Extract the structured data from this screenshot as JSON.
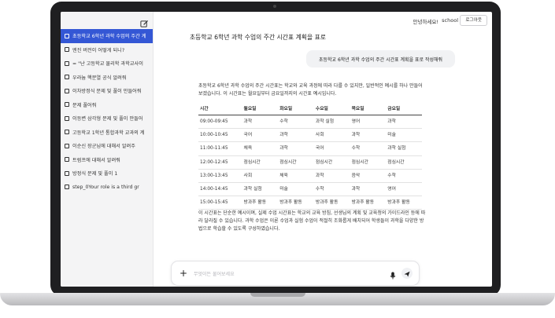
{
  "topbar": {
    "greeting": "안녕하세요!",
    "username": "school",
    "logout_label": "로그아웃"
  },
  "sidebar": {
    "conversations": [
      {
        "label": "초등학교 6학년 과학 수업의 주간 계",
        "active": true
      },
      {
        "label": "엔진 버전이 어떻게 되니?",
        "active": false
      },
      {
        "label": "= \"난 고등학교 물리학 과학교사이",
        "active": false
      },
      {
        "label": "우라늄 핵분열 공식 알려줘",
        "active": false
      },
      {
        "label": "이차방정식 문제 및 풀이 만들어줘",
        "active": false
      },
      {
        "label": "문제 풀어줘",
        "active": false
      },
      {
        "label": "이등변 삼각형 문제 및 풀이 만들어",
        "active": false
      },
      {
        "label": "고등학교 1학년 통합과학 교과의 계",
        "active": false
      },
      {
        "label": "이순신 장군님에 대해서 알려주",
        "active": false
      },
      {
        "label": "트럼프에 대해서 알려줘",
        "active": false
      },
      {
        "label": "방정식 문제 및 풀이 1",
        "active": false
      },
      {
        "label": "step_0Your role is a third gr",
        "active": false
      }
    ]
  },
  "chat": {
    "title": "초등학교 6학년 과학 수업의 주간 시간표 계획을 표로",
    "user_message": "초등학교 6학년 과학 수업의 주간 시간표 계획을 표로 작성해줘",
    "intro": "초등학교 6학년 과학 수업의 주간 시간표는 학교와 교육 과정에 따라 다를 수 있지만, 일반적인 예시를 하나 만들어 보겠습니다. 이 시간표는 월요일부터 금요일까지의 시간표 예시입니다.",
    "table": {
      "headers": [
        "시간",
        "월요일",
        "화요일",
        "수요일",
        "목요일",
        "금요일"
      ],
      "rows": [
        [
          "09:00-09:45",
          "과학",
          "수학",
          "과학 실험",
          "영어",
          "과학"
        ],
        [
          "10:00-10:45",
          "국어",
          "과학",
          "사회",
          "과학",
          "미술"
        ],
        [
          "11:00-11:45",
          "체육",
          "과학",
          "국어",
          "수학",
          "과학 실험"
        ],
        [
          "12:00-12:45",
          "점심시간",
          "점심시간",
          "점심시간",
          "점심시간",
          "점심시간"
        ],
        [
          "13:00-13:45",
          "사회",
          "체육",
          "과학",
          "음악",
          "수학"
        ],
        [
          "14:00-14:45",
          "과학 실험",
          "미술",
          "수학",
          "과학",
          "영어"
        ],
        [
          "15:00-15:45",
          "방과후 활동",
          "방과후 활동",
          "방과후 활동",
          "방과후 활동",
          "방과후 활동"
        ]
      ]
    },
    "outro": "이 시간표는 단순한 예시이며, 실제 수업 시간표는 학교의 교육 방침, 선생님의 계획 및 교육청의 가이드라인 등에 따라 달라질 수 있습니다. 과학 수업은 이론 수업과 실험 수업이 적절히 조화롭게 배치되어 학생들이 과학을 다양한 방법으로 학습할 수 있도록 구성하였습니다."
  },
  "input": {
    "placeholder": "무엇이든 물어보세요"
  },
  "icons": {
    "new_chat": "edit-icon",
    "conversation": "chat-square-icon",
    "plus": "plus-icon",
    "mic": "mic-icon",
    "send": "send-icon"
  },
  "colors": {
    "active_item": "#3457d5",
    "sidebar_bg": "#f4f4f5"
  }
}
